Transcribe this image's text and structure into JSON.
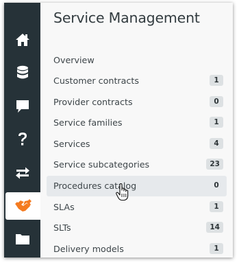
{
  "page": {
    "title": "Service Management"
  },
  "rail": {
    "items": [
      {
        "icon": "home-icon"
      },
      {
        "icon": "database-icon"
      },
      {
        "icon": "chat-icon"
      },
      {
        "icon": "help-icon"
      },
      {
        "icon": "exchange-arrows-icon"
      },
      {
        "icon": "handshake-icon",
        "active": true
      },
      {
        "icon": "folder-icon"
      }
    ],
    "active_color": "#f47b20"
  },
  "menu": {
    "items": [
      {
        "label": "Overview"
      },
      {
        "label": "Customer contracts",
        "count": "1"
      },
      {
        "label": "Provider contracts",
        "count": "0"
      },
      {
        "label": "Service families",
        "count": "1"
      },
      {
        "label": "Services",
        "count": "4"
      },
      {
        "label": "Service subcategories",
        "count": "23"
      },
      {
        "label": "Procedures catalog",
        "count": "0",
        "active": true
      },
      {
        "label": "SLAs",
        "count": "1"
      },
      {
        "label": "SLTs",
        "count": "14"
      },
      {
        "label": "Delivery models",
        "count": "1"
      }
    ]
  }
}
